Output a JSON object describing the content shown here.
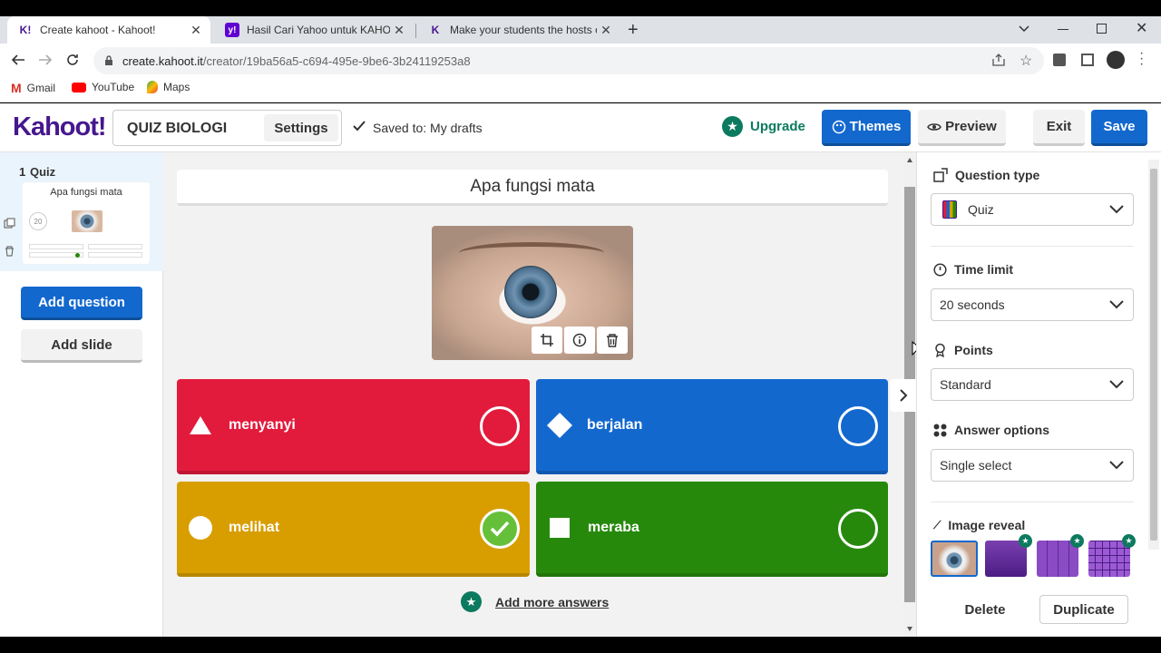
{
  "browser": {
    "tabs": [
      {
        "favicon": "K!",
        "title": "Create kahoot - Kahoot!",
        "active": true
      },
      {
        "favicon": "y!",
        "title": "Hasil Cari Yahoo untuk KAHOOT",
        "active": false
      },
      {
        "favicon": "K",
        "title": "Make your students the hosts of",
        "active": false
      }
    ],
    "url_host": "create.kahoot.it",
    "url_path": "/creator/19ba56a5-c694-495e-9be6-3b24119253a8",
    "bookmarks": [
      "Gmail",
      "YouTube",
      "Maps"
    ]
  },
  "header": {
    "logo": "Kahoot!",
    "kahoot_title": "QUIZ BIOLOGI",
    "settings_label": "Settings",
    "saved_status": "Saved to: My drafts",
    "upgrade_label": "Upgrade",
    "themes_label": "Themes",
    "preview_label": "Preview",
    "exit_label": "Exit",
    "save_label": "Save"
  },
  "sidebar": {
    "question_number": "1",
    "question_type": "Quiz",
    "question_preview": "Apa fungsi mata",
    "time_badge": "20",
    "add_question_label": "Add question",
    "add_slide_label": "Add slide"
  },
  "editor": {
    "question_text": "Apa fungsi mata",
    "answers": [
      {
        "text": "menyanyi",
        "shape": "triangle-icon",
        "color": "#e21b3c",
        "correct": false
      },
      {
        "text": "berjalan",
        "shape": "diamond-icon",
        "color": "#1368ce",
        "correct": false
      },
      {
        "text": "melihat",
        "shape": "circle-icon",
        "color": "#d89e00",
        "correct": true
      },
      {
        "text": "meraba",
        "shape": "square-icon",
        "color": "#26890c",
        "correct": false
      }
    ],
    "add_more_answers_label": "Add more answers"
  },
  "settings_panel": {
    "question_type_label": "Question type",
    "question_type_value": "Quiz",
    "time_limit_label": "Time limit",
    "time_limit_value": "20 seconds",
    "points_label": "Points",
    "points_value": "Standard",
    "answer_options_label": "Answer options",
    "answer_options_value": "Single select",
    "image_reveal_label": "Image reveal",
    "delete_label": "Delete",
    "duplicate_label": "Duplicate"
  },
  "colors": {
    "brand_blue": "#1368ce",
    "brand_purple": "#46178f",
    "upgrade_green": "#0c7a5f"
  }
}
